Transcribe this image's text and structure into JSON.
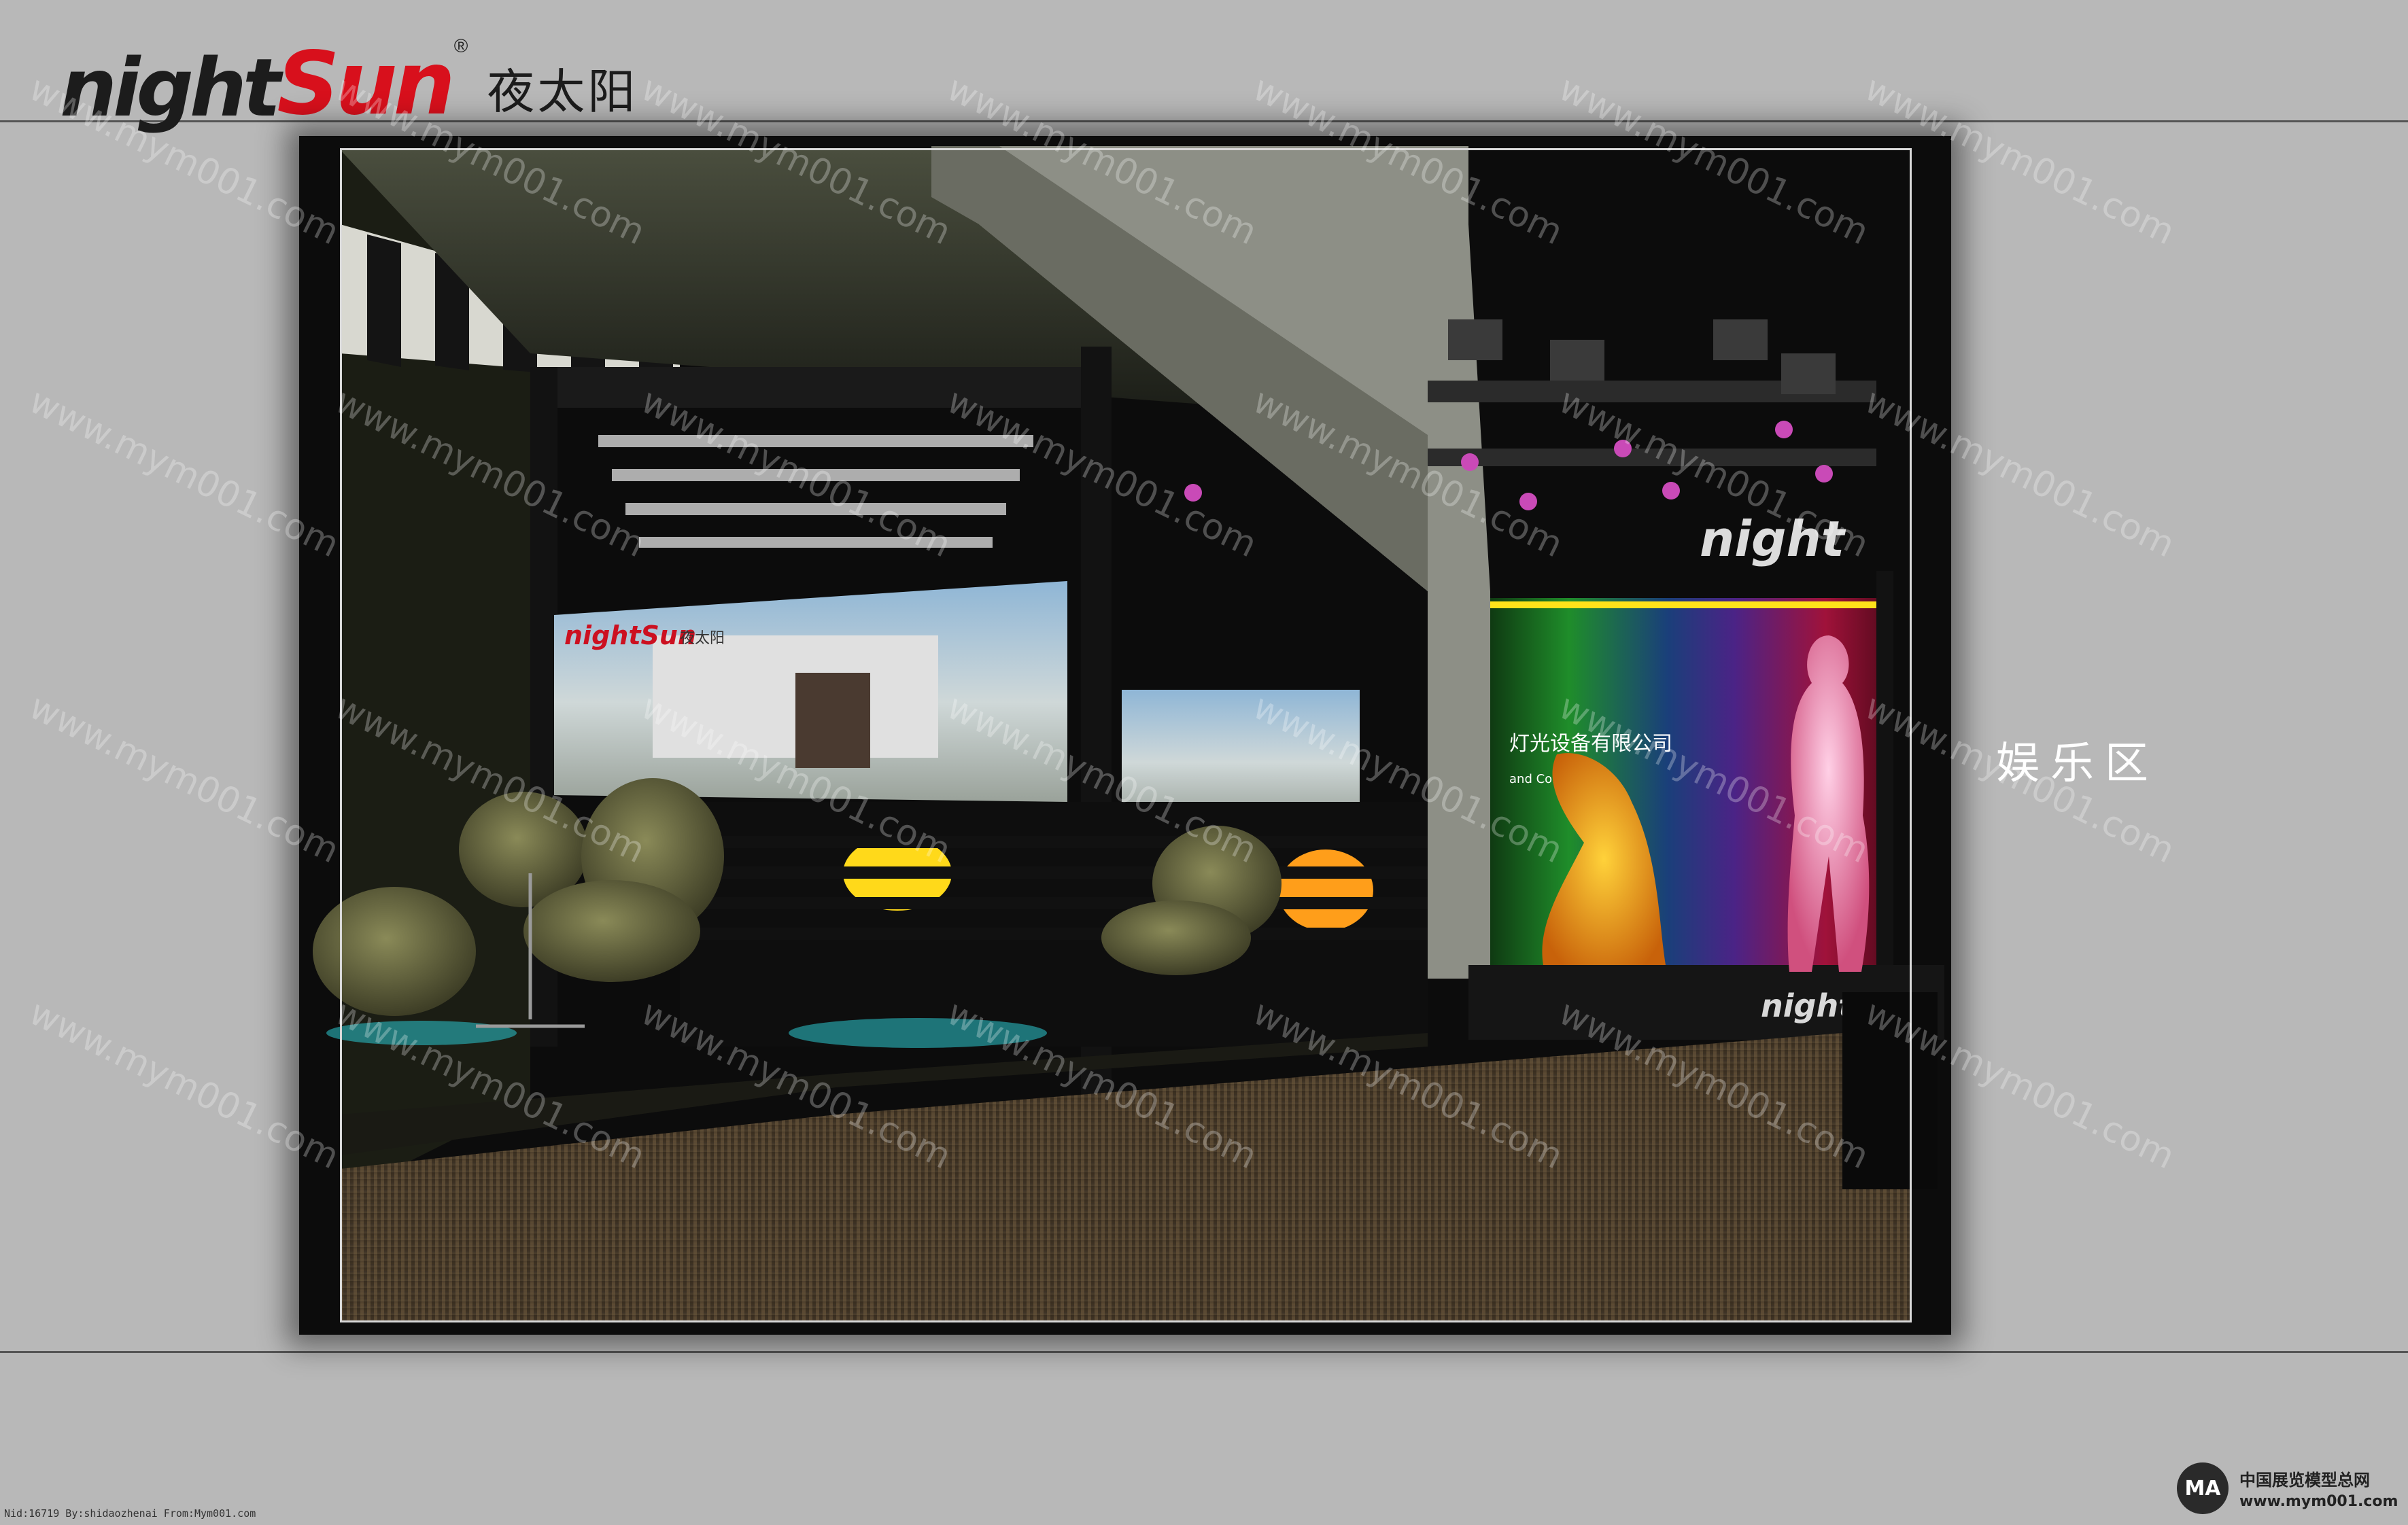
{
  "header": {
    "brand_night": "night",
    "brand_sun": "Sun",
    "brand_registered": "®",
    "brand_cn": "夜太阳"
  },
  "scene": {
    "billboard_brand": "nightSun",
    "billboard_cn": "夜太阳",
    "stage_company_cn": "灯光设备有限公司",
    "stage_company_en": "and Co., Ltd.",
    "stage_logo": "night",
    "stage_front_logo": "night"
  },
  "zone_label": "娱乐区",
  "watermark": "www.mym001.com",
  "footer": {
    "info": "Nid:16719 By:shidaozhenai From:Mym001.com",
    "site_cn": "中国展览模型总网",
    "site_url": "www.mym001.com",
    "site_icon": "MA"
  },
  "colors": {
    "brand_red": "#d8101c",
    "page_bg": "#b8b8b8",
    "frame_bg": "#0c0c0c"
  }
}
